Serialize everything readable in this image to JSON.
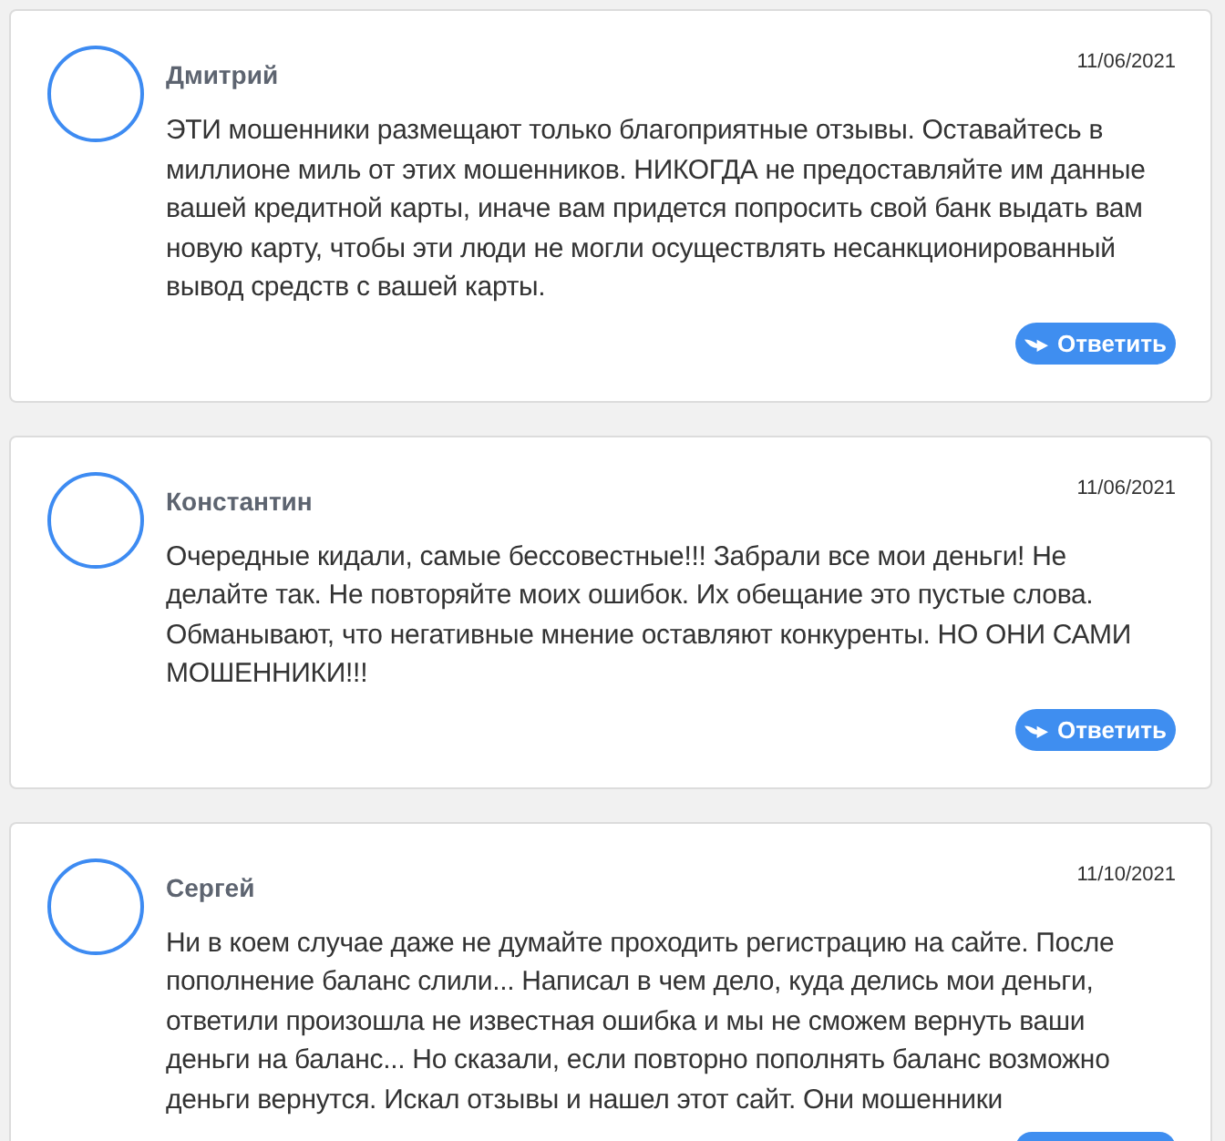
{
  "reviews": [
    {
      "author": "Дмитрий",
      "date": "11/06/2021",
      "text": "ЭТИ мошенники размещают только благоприятные отзывы. Оставайтесь в миллионе миль от этих мошенников. НИКОГДА не предоставляйте им данные вашей кредитной карты, иначе вам придется попросить свой банк выдать вам новую карту, чтобы эти люди не могли осуществлять несанкционированный вывод средств с вашей карты.",
      "reply_button": {
        "label": "Ответить",
        "cut_off": false
      }
    },
    {
      "author": "Константин",
      "date": "11/06/2021",
      "text": "Очередные кидали, самые бессовестные!!! Забрали все мои деньги! Не делайте так. Не повторяйте моих ошибок. Их обещание это пустые слова. Обманывают, что негативные мнение оставляют конкуренты. НО ОНИ САМИ МОШЕННИКИ!!!",
      "reply_button": {
        "label": "Ответить",
        "cut_off": false
      }
    },
    {
      "author": "Сергей",
      "date": "11/10/2021",
      "text": "Ни в коем случае даже не думайте проходить регистрацию на сайте. После пополнение баланс слили... Написал в чем дело, куда делись мои деньги, ответили произошла не известная ошибка и мы не сможем вернуть ваши деньги на баланс... Но сказали, если повторно пополнять баланс возможно деньги вернутся. Искал отзывы и нашел этот сайт. Они мошенники",
      "reply_button": {
        "cut_off": true
      }
    }
  ]
}
